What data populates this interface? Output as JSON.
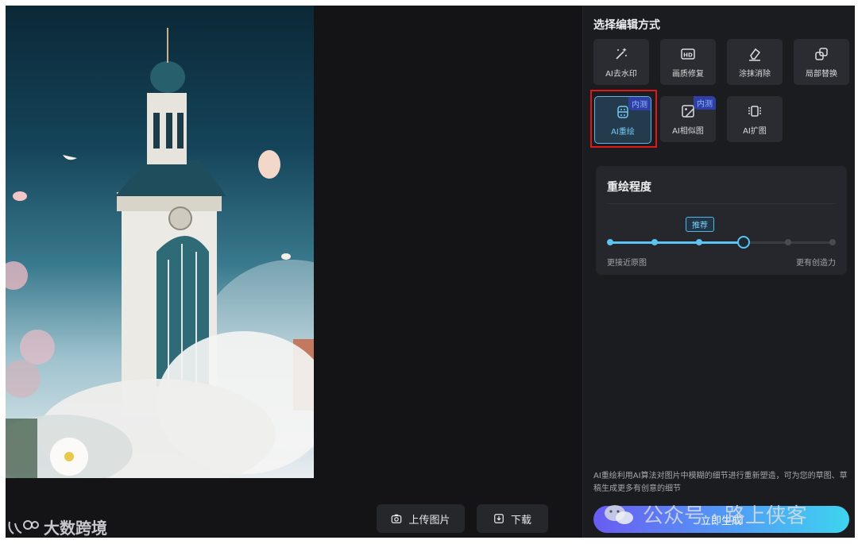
{
  "panel": {
    "title": "选择编辑方式",
    "tools": [
      {
        "label": "AI去水印",
        "icon": "magic-wand-icon"
      },
      {
        "label": "画质修复",
        "icon": "hd-icon"
      },
      {
        "label": "涂抹消除",
        "icon": "eraser-icon"
      },
      {
        "label": "局部替换",
        "icon": "replace-icon"
      },
      {
        "label": "AI重绘",
        "icon": "robot-icon",
        "badge": "内测",
        "active": true
      },
      {
        "label": "AI相似图",
        "icon": "similar-image-icon",
        "badge": "内测"
      },
      {
        "label": "AI扩图",
        "icon": "expand-icon"
      }
    ],
    "redraw": {
      "title": "重绘程度",
      "recommend_tag": "推荐",
      "min_label": "更接近原图",
      "max_label": "更有创造力",
      "steps": 6,
      "value_step": 3
    },
    "description": "AI重绘利用AI算法对图片中模糊的细节进行重新塑造，可为您的草图、草稿生成更多有创意的细节",
    "generate_label": "立即生成"
  },
  "canvas": {
    "upload_label": "上传图片",
    "download_label": "下载"
  },
  "watermarks": {
    "brand": "大数跨境",
    "account": "公众号 · 路上侠客"
  },
  "colors": {
    "accent": "#5cc4f3",
    "highlight": "#e01818",
    "badge": "#2f3fa6"
  }
}
